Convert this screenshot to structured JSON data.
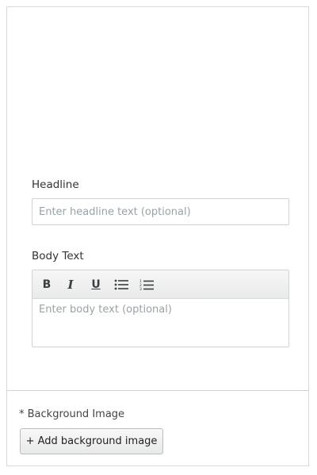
{
  "headline": {
    "label": "Headline",
    "placeholder": "Enter headline text (optional)"
  },
  "body_text": {
    "label": "Body Text",
    "toolbar": {
      "bold": "B",
      "italic": "I",
      "underline": "U",
      "bulleted_list_icon": "bulleted-list-icon",
      "numbered_list_icon": "numbered-list-icon"
    },
    "placeholder": "Enter body text (optional)"
  },
  "background_image": {
    "label": "* Background Image",
    "button_label": "+ Add background image"
  }
}
